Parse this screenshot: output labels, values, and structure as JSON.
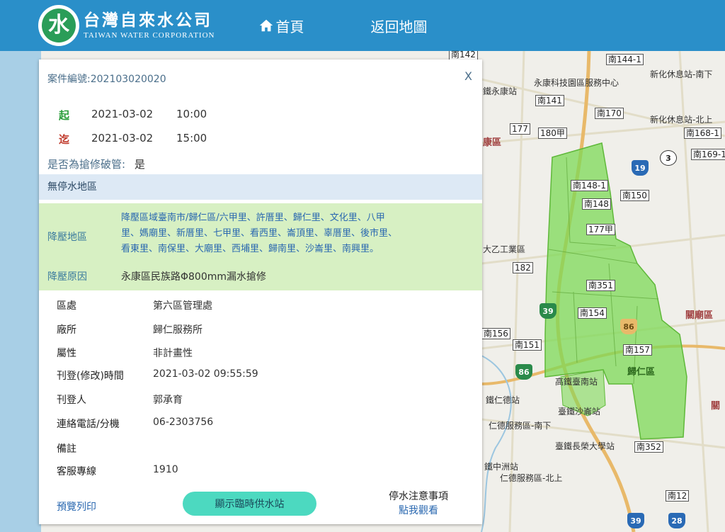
{
  "header": {
    "logo_mark": "水",
    "logo_zh": "台灣自來水公司",
    "logo_en": "TAIWAN WATER CORPORATION",
    "nav": {
      "home": "首頁",
      "back_to_map": "返回地圖"
    }
  },
  "panel": {
    "case_title": "案件編號:202103020020",
    "close": "X",
    "start": {
      "tag": "起",
      "date": "2021-03-02",
      "time": "10:00"
    },
    "end": {
      "tag": "迄",
      "date": "2021-03-02",
      "time": "15:00"
    },
    "repair_question": "是否為搶修破管:",
    "repair_answer": "是",
    "no_outage": "無停水地區",
    "reduce": {
      "areas_label": "降壓地區",
      "areas_lines": [
        "降壓區域臺南市/歸仁區/六甲里、許厝里、歸仁里、文化里、八甲",
        "里、媽廟里、新厝里、七甲里、看西里、崙頂里、辜厝里、後市里、",
        "看東里、南保里、大廟里、西埔里、歸南里、沙崙里、南興里。"
      ],
      "reason_label": "降壓原因",
      "reason": "永康區民族路Φ800mm漏水搶修"
    },
    "info": [
      {
        "label": "區處",
        "value": "第六區管理處"
      },
      {
        "label": "廠所",
        "value": "歸仁服務所"
      },
      {
        "label": "屬性",
        "value": "非計畫性"
      },
      {
        "label": "刊登(修改)時間",
        "value": "2021-03-02 09:55:59"
      },
      {
        "label": "刊登人",
        "value": "郭承育"
      },
      {
        "label": "連絡電話/分機",
        "value": "06-2303756"
      },
      {
        "label": "備註",
        "value": ""
      },
      {
        "label": "客服專線",
        "value": "1910"
      }
    ],
    "preview_print": "預覽列印",
    "supply_button": "顯示臨時供水站",
    "notice_title": "停水注意事項",
    "notice_link": "點我觀看"
  },
  "map": {
    "labels": [
      "南142",
      "南144-1",
      "永康科技園區服務中心",
      "新化休息站-南下",
      "鐵永康站",
      "南141",
      "南170",
      "新化休息站-北上",
      "177",
      "180甲",
      "南168-1",
      "康區",
      "南169-1",
      "南148-1",
      "南150",
      "南148",
      "177甲",
      "大乙工業區",
      "182",
      "南351",
      "南154",
      "關廟區",
      "南156",
      "南151",
      "南157",
      "歸仁區",
      "高鐵臺南站",
      "鐵仁德站",
      "臺鐵沙崙站",
      "仁德服務區-南下",
      "臺鐵長榮大學站",
      "南352",
      "鐵中洲站",
      "仁德服務區-北上",
      "南12",
      "關"
    ],
    "highways": [
      "39",
      "86",
      "86",
      "3",
      "19",
      "39",
      "28"
    ],
    "colors": {
      "outage_zone": "#7ed957",
      "highway_blue": "#2a6ab5",
      "highway_green": "#2a8a4a"
    }
  }
}
